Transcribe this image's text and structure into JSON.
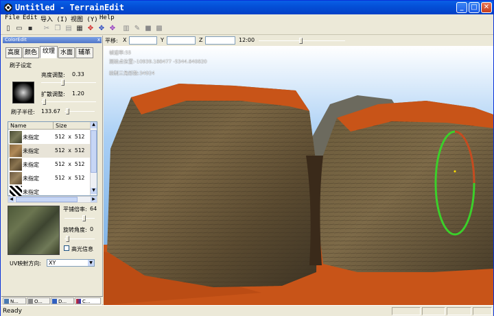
{
  "window": {
    "title": "Untitled - TerrainEdit",
    "icons": {
      "app": "terrain-app-icon",
      "minimize": "minimize-icon",
      "maximize": "maximize-icon",
      "close": "close-icon"
    },
    "caption_glyphs": {
      "minimize": "_",
      "maximize": "□",
      "close": "✕"
    }
  },
  "menu": [
    {
      "label": "File"
    },
    {
      "label": "Edit"
    },
    {
      "label": "导入 (I)"
    },
    {
      "label": "视图 (Y)"
    },
    {
      "label": "Help"
    }
  ],
  "toolbar": {
    "buttons": [
      {
        "icon": "new-file-icon",
        "glyph": "▯"
      },
      {
        "icon": "open-folder-icon",
        "glyph": "▭"
      },
      {
        "icon": "save-icon",
        "glyph": "▪"
      },
      {
        "icon": "cut-icon",
        "glyph": "✂"
      },
      {
        "icon": "copy-icon",
        "glyph": "❐"
      },
      {
        "icon": "paste-icon",
        "glyph": "▤"
      },
      {
        "icon": "grid-icon",
        "glyph": "▦"
      },
      {
        "icon": "move-red-icon",
        "glyph": "✥"
      },
      {
        "icon": "move-blue-icon",
        "glyph": "✥"
      },
      {
        "icon": "move-purple-icon",
        "glyph": "✥"
      },
      {
        "icon": "layer-icon",
        "glyph": "▥"
      },
      {
        "icon": "brush-tool-icon",
        "glyph": "✎"
      },
      {
        "icon": "fill-icon",
        "glyph": "■"
      },
      {
        "icon": "checker-icon",
        "glyph": "▩"
      }
    ]
  },
  "panel": {
    "header": "ColorEdit",
    "close_glyph": "x",
    "tabs": [
      {
        "label": "高度"
      },
      {
        "label": "颜色"
      },
      {
        "label": "纹理",
        "active": true
      },
      {
        "label": "水面"
      },
      {
        "label": "辅革"
      }
    ],
    "brush_group_label": "刷子设定",
    "brightness_label": "亮度调整:",
    "brightness_value": "0.33",
    "spread_label": "扩散调整:",
    "spread_value": "1.20",
    "radius_label": "刷子半径:",
    "radius_value": "133.67",
    "list_headers": {
      "name": "Name",
      "size": "Size"
    },
    "list_rows": [
      {
        "name": "未指定",
        "size": "512 x 512",
        "swatch": "#6d6a52"
      },
      {
        "name": "未指定",
        "size": "512 x 512",
        "swatch": "#8a7a58"
      },
      {
        "name": "未指定",
        "size": "512 x 512",
        "swatch": "#5f5a42"
      },
      {
        "name": "未指定",
        "size": "512 x 512",
        "swatch": "#726650"
      },
      {
        "name": "未指定",
        "size": "",
        "swatch": "#222222"
      }
    ],
    "tile_rate_label": "平铺倍率:",
    "tile_rate_value": "64",
    "rotation_label": "旋转角度:",
    "rotation_value": "0",
    "highlight_label": "高光信息",
    "uv_label": "UV映射方向:",
    "uv_value": "XY"
  },
  "bottom_tabs": [
    {
      "label": "N...",
      "icon": "node-icon"
    },
    {
      "label": "O...",
      "icon": "object-icon"
    },
    {
      "label": "D...",
      "icon": "display-icon"
    },
    {
      "label": "C...",
      "icon": "color-icon"
    }
  ],
  "viewbar": {
    "move_label": "平移:",
    "x_label": "X",
    "y_label": "Y",
    "z_label": "Z",
    "x_value": "",
    "y_value": "",
    "z_value": "",
    "time_label": "12:00"
  },
  "viewport": {
    "lines": [
      "帧速率:55",
      "测绘点位置:-10939.188477 -5344.840820",
      "绘制三角形数:34924"
    ]
  },
  "status": {
    "text": "Ready"
  },
  "colors": {
    "title_bar": "#0450d8",
    "sky": "#7fb4e8",
    "ground": "#c85418",
    "rock": "#6e5a3c"
  }
}
